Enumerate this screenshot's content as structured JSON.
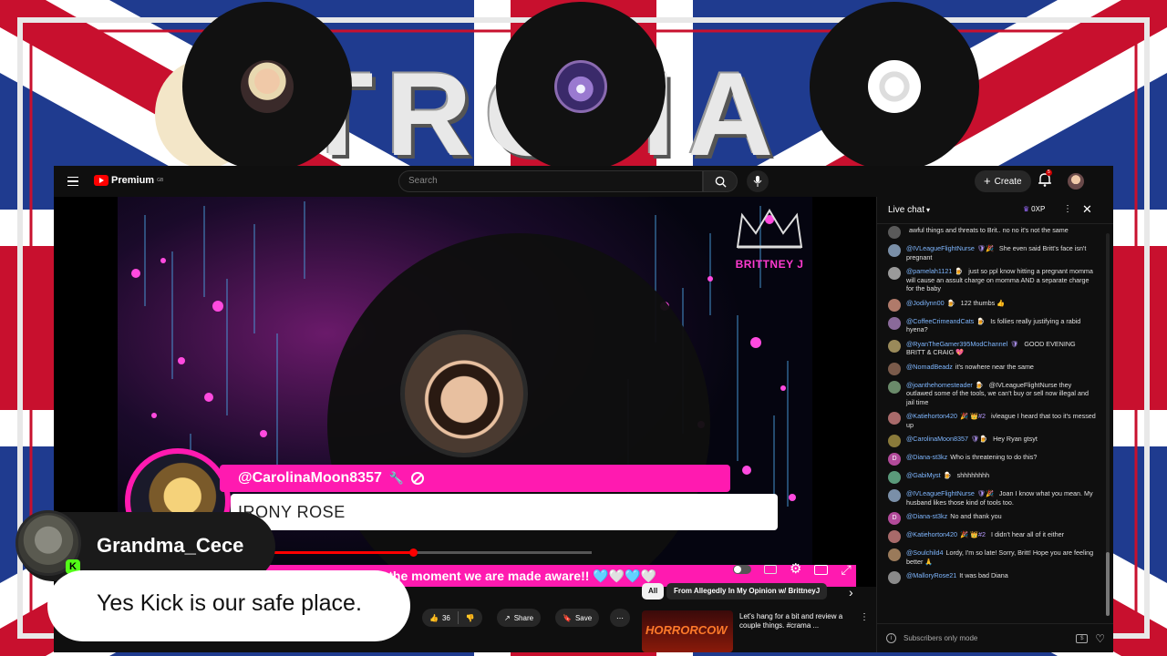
{
  "colors": {
    "brand_red": "#ff0000",
    "accent_pink": "#ff1ab0",
    "bg": "#0f0f0f",
    "flag_blue": "#1f3b8f",
    "flag_red": "#c8102e"
  },
  "banner": {
    "text": "TROHA"
  },
  "header": {
    "brand": "Premium",
    "brand_sup": "GB",
    "search_placeholder": "Search",
    "create_label": "Create",
    "notif_count": "5"
  },
  "video": {
    "channel_logo": "BRITTNEY J",
    "guest_handle": "@CarolinaMoon8357",
    "guest_name": "IRONY ROSE",
    "ticker": "ge the moment we are made aware!! 🩵🤍🩵🤍",
    "progress": 0.5
  },
  "actions": {
    "like_count": "36",
    "share_label": "Share",
    "save_label": "Save"
  },
  "filters": {
    "all_label": "All",
    "from_label": "From Allegedly In My Opinion w/ BrittneyJ"
  },
  "reco": {
    "thumb_text": "HORRORCOW",
    "title": "Let's hang for a bit and review a couple things. #crama ..."
  },
  "chat": {
    "title": "Live chat",
    "points": "0XP",
    "input_placeholder": "Subscribers only mode",
    "messages": [
      {
        "user": "",
        "text": "awful things and threats to Brit.. no no it's not the same",
        "color": "#5a5a5a",
        "badge": ""
      },
      {
        "user": "@IVLeagueFlightNurse",
        "text": "She even said Britt's face isn't pregnant",
        "color": "#7a8fa8",
        "badge": "🛡🎉"
      },
      {
        "user": "@pamelah1121",
        "text": "just so ppl know hitting a pregnant momma will cause an assult charge on momma AND a separate charge for the baby",
        "color": "#9a9a9a",
        "badge": "🍺"
      },
      {
        "user": "@Jodilynn00",
        "text": "122 thumbs 👍",
        "color": "#b07a6a",
        "badge": "🍺"
      },
      {
        "user": "@CoffeeCrimeandCats",
        "text": "Is follies really justifying a rabid hyena?",
        "color": "#8a6a9a",
        "badge": "🍺"
      },
      {
        "user": "@RyanTheGamer395ModChannel",
        "text": "GOOD EVENING BRITT & CRAIG 💖",
        "color": "#9a8a5a",
        "badge": "🛡"
      },
      {
        "user": "@NomadBeadz",
        "text": "it's nowhere near the same",
        "color": "#7a5a4a",
        "badge": ""
      },
      {
        "user": "@joanthehomesteader",
        "text": "@IVLeagueFlightNurse they outlawed some of the tools, we can't buy or sell now illegal and jail time",
        "color": "#6a8a6a",
        "badge": "🍺"
      },
      {
        "user": "@Katiehorton420",
        "text": "ivleague I heard that too it's messed up",
        "color": "#a86a6a",
        "badge": "🎉 👑#2"
      },
      {
        "user": "@CarolinaMoon8357",
        "text": "Hey Ryan gtsyt",
        "color": "#8a7a3a",
        "badge": "🛡🍺"
      },
      {
        "user": "@Diana-st3kz",
        "text": "Who is threatening to do this?",
        "color": "#b24a9a",
        "badge": "",
        "initial": "D"
      },
      {
        "user": "@GabiMyst",
        "text": "shhhhhhhh",
        "color": "#5a9a7a",
        "badge": "🍺"
      },
      {
        "user": "@IVLeagueFlightNurse",
        "text": "Joan I know what you mean. My husband likes those kind of tools too.",
        "color": "#7a8fa8",
        "badge": "🛡🎉"
      },
      {
        "user": "@Diana-st3kz",
        "text": "No and thank you",
        "color": "#b24a9a",
        "badge": "",
        "initial": "D"
      },
      {
        "user": "@Katiehorton420",
        "text": "I didn't hear all of it either",
        "color": "#a86a6a",
        "badge": "🎉 👑#2"
      },
      {
        "user": "@Soulchild4",
        "text": "Lordy, I'm so late! Sorry, Britt! Hope you are feeling better 🙏",
        "color": "#9a7a5a",
        "badge": ""
      },
      {
        "user": "@MalloryRose21",
        "text": "It was bad Diana",
        "color": "#8a8a8a",
        "badge": ""
      }
    ]
  },
  "overlay": {
    "username": "Grandma_Cece",
    "message": "Yes Kick is our safe place.",
    "platform_badge": "K"
  },
  "icons": [
    "menu-icon",
    "youtube-logo-icon",
    "search-icon",
    "mic-icon",
    "plus-icon",
    "bell-icon",
    "chevron-down-icon",
    "more-icon",
    "close-icon",
    "like-icon",
    "dislike-icon",
    "share-icon",
    "save-icon",
    "settings-icon",
    "fullscreen-icon",
    "emoji-icon",
    "heart-icon",
    "dollar-icon",
    "wrench-icon",
    "block-icon",
    "crown-icon"
  ]
}
